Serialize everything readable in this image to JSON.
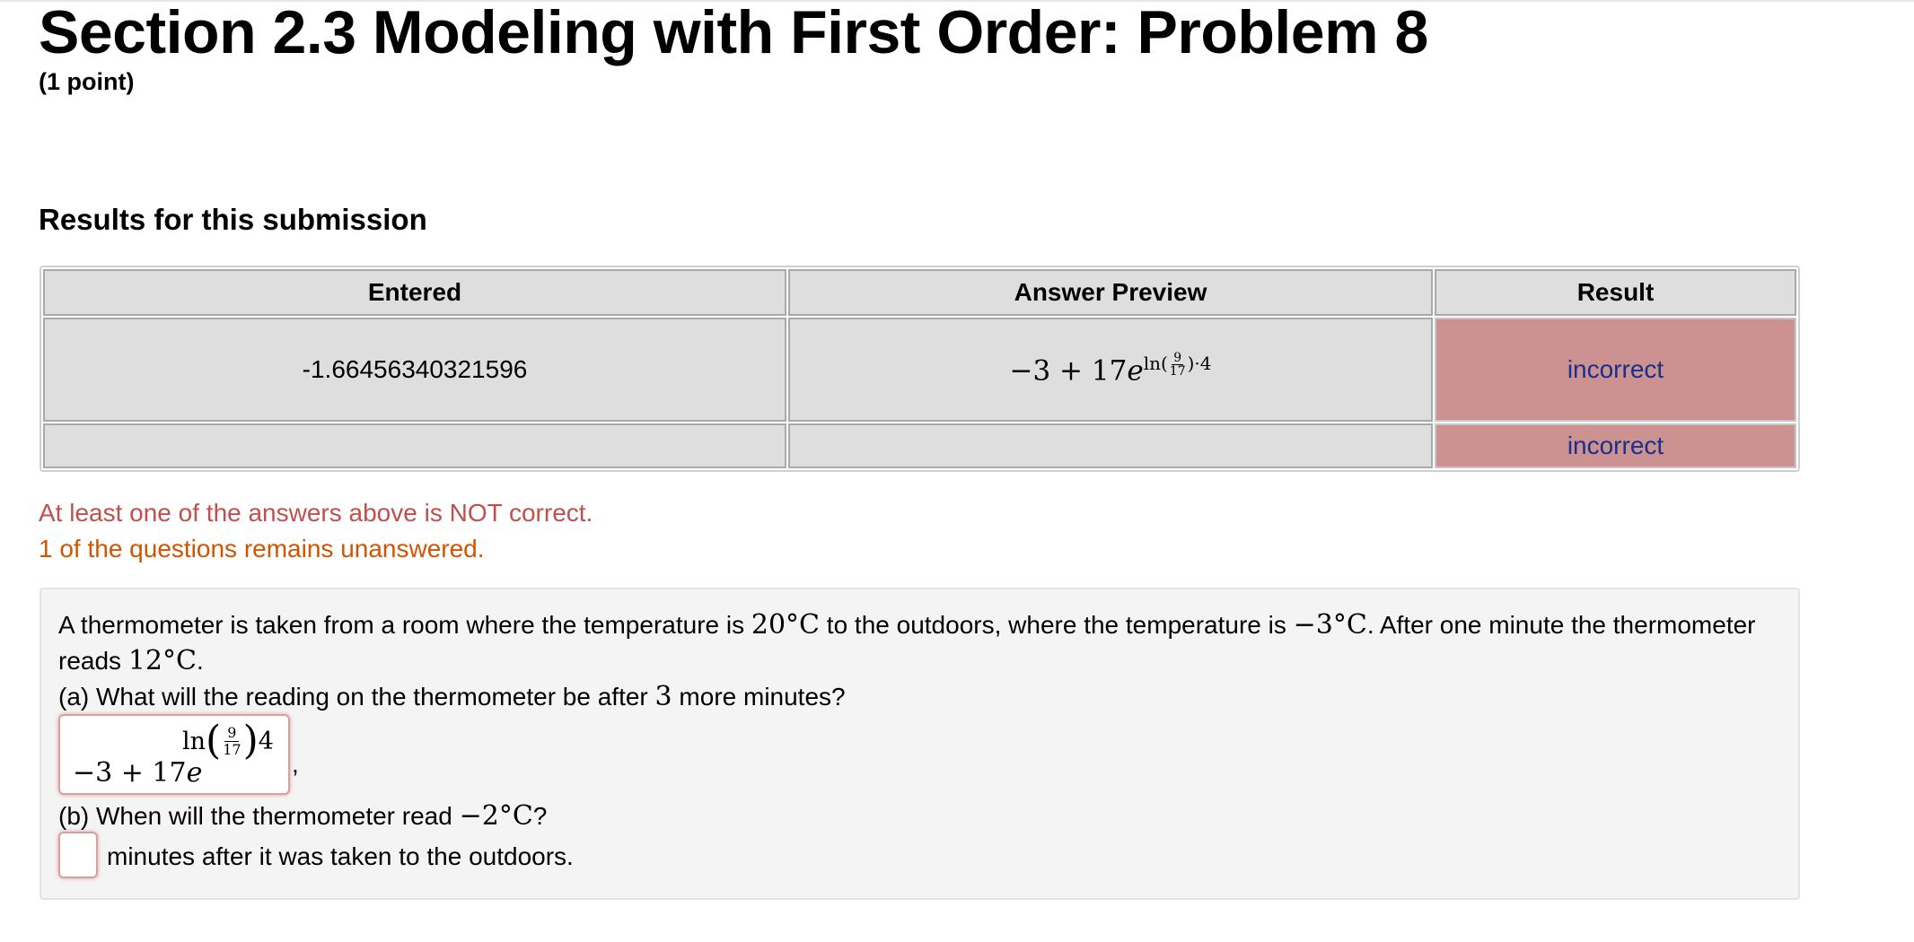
{
  "page": {
    "title": "Section 2.3 Modeling with First Order: Problem 8",
    "points": "(1 point)",
    "results_heading": "Results for this submission"
  },
  "results_table": {
    "headers": [
      "Entered",
      "Answer Preview",
      "Result"
    ],
    "rows": [
      {
        "entered": "-1.66456340321596",
        "preview": "−3 + 17e^(ln(9/17)·4)",
        "result": "incorrect"
      },
      {
        "entered": "",
        "preview": "",
        "result": "incorrect"
      }
    ]
  },
  "messages": {
    "not_correct": "At least one of the answers above is NOT correct.",
    "unanswered": "1 of the questions remains unanswered."
  },
  "problem": {
    "intro_line1_a": "A thermometer is taken from a room where the temperature is ",
    "temp_room": "20°C",
    "intro_line1_b": " to the outdoors, where the temperature is ",
    "temp_out": "−3°C",
    "intro_line1_c": ". After one minute the thermometer",
    "intro_line2_a": "reads ",
    "temp_read": "12°C",
    "intro_line2_b": ".",
    "part_a_q1": "(a) What will the reading on the thermometer be after ",
    "part_a_num": "3",
    "part_a_q2": " more minutes?",
    "answer_a_value": "−3 + 17e^(ln(9/17)4)",
    "part_b_q1": "(b) When will the thermometer read ",
    "part_b_temp": "−2°C",
    "part_b_q2": "?",
    "answer_b_value": "",
    "part_b_suffix": "minutes after it was taken to the outdoors."
  },
  "colors": {
    "incorrect_bg": "#cc9292",
    "incorrect_text": "#1a2f8a",
    "error_red": "#c0504d",
    "warning_orange": "#d35400"
  }
}
